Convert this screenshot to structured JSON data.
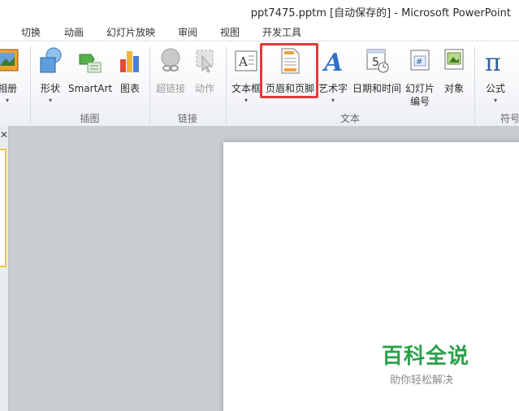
{
  "window": {
    "title": "ppt7475.pptm [自动保存的] - Microsoft PowerPoint"
  },
  "tabs": [
    "切换",
    "动画",
    "幻灯片放映",
    "审阅",
    "视图",
    "开发工具"
  ],
  "ribbon": {
    "buttons": {
      "album": "相册",
      "shapes": "形状",
      "smartart": "SmartArt",
      "chart": "图表",
      "hyperlink": "超链接",
      "action": "动作",
      "textbox": "文本框",
      "header_footer": "页眉和页脚",
      "wordart": "艺术字",
      "datetime": "日期和时间",
      "slide_number_line1": "幻灯片",
      "slide_number_line2": "编号",
      "object": "对象",
      "equation": "公式"
    },
    "groups": {
      "illustrations": "插图",
      "links": "链接",
      "text": "文本",
      "symbols": "符号"
    },
    "icons": {
      "wordart_glyph": "A",
      "equation_glyph": "π",
      "datetime_glyph": "5",
      "slide_number_glyph": "#"
    }
  },
  "panes": {
    "close_glyph": "✕"
  },
  "watermark": {
    "main": "百科全说",
    "sub": "助你轻松解决"
  },
  "colors": {
    "highlight": "#e13b3b",
    "watermark_green": "#2aa14a"
  }
}
